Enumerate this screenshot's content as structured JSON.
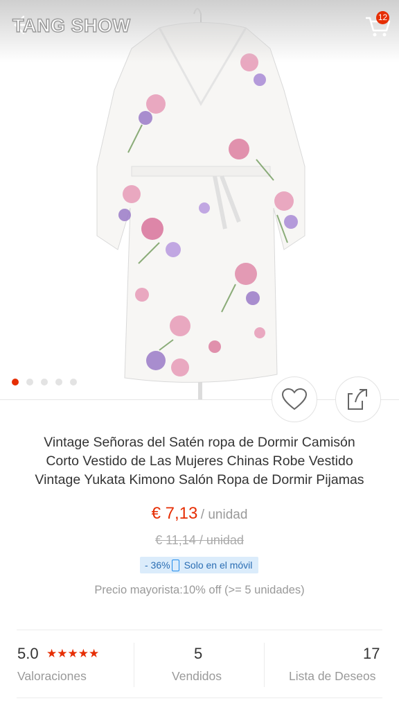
{
  "header": {
    "brand": "TANG SHOW",
    "cart_count": "12"
  },
  "gallery": {
    "image_count": 5,
    "active_index": 0
  },
  "product": {
    "title_lines": [
      "Vintage Señoras del Satén ropa de Dormir Camisón",
      "Corto Vestido de Las Mujeres Chinas Robe Vestido",
      "Vintage Yukata Kimono Salón Ropa de Dormir Pijamas"
    ],
    "price": "€ 7,13",
    "price_unit": "/ unidad",
    "old_price": "€ 11,14  / unidad",
    "discount": "- 36%",
    "mobile_only": "Solo en el móvil",
    "wholesale": "Precio mayorista:10% off (>= 5 unidades)"
  },
  "stats": {
    "rating": "5.0",
    "rating_stars": "★★★★★",
    "rating_label": "Valoraciones",
    "sold": "5",
    "sold_label": "Vendidos",
    "wishlist": "17",
    "wishlist_label": "Lista de Deseos"
  },
  "colors": {
    "accent": "#e62e04",
    "promo_bg": "#dbecfb",
    "promo_text": "#2a6db3"
  },
  "icons": [
    "back-arrow-icon",
    "cart-icon",
    "heart-icon",
    "share-icon",
    "phone-icon"
  ]
}
